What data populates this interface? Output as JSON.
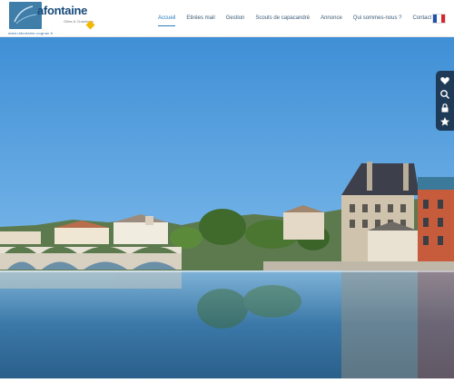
{
  "brand": {
    "name": "afontaine",
    "tagline": "Gîtes & Chambres",
    "url": "www.lafontaine-cognac.fr"
  },
  "nav": {
    "items": [
      {
        "label": "Accueil",
        "active": true
      },
      {
        "label": "Etirées mail",
        "active": false
      },
      {
        "label": "Gestion",
        "active": false
      },
      {
        "label": "Scouts de capacandré",
        "active": false
      },
      {
        "label": "Annonce",
        "active": false
      },
      {
        "label": "Qui sommes-nous ?",
        "active": false
      },
      {
        "label": "Contact",
        "active": false
      }
    ]
  },
  "language": {
    "flag": "fr-flag-icon"
  },
  "side_toolbar": {
    "icons": [
      "heart-icon",
      "search-icon",
      "lock-icon",
      "star-icon"
    ]
  },
  "colors": {
    "accent": "#2a7cc1",
    "toolbar_bg": "#1f3a57",
    "sky_top": "#3f8fd6",
    "water": "#2a5f8a"
  }
}
